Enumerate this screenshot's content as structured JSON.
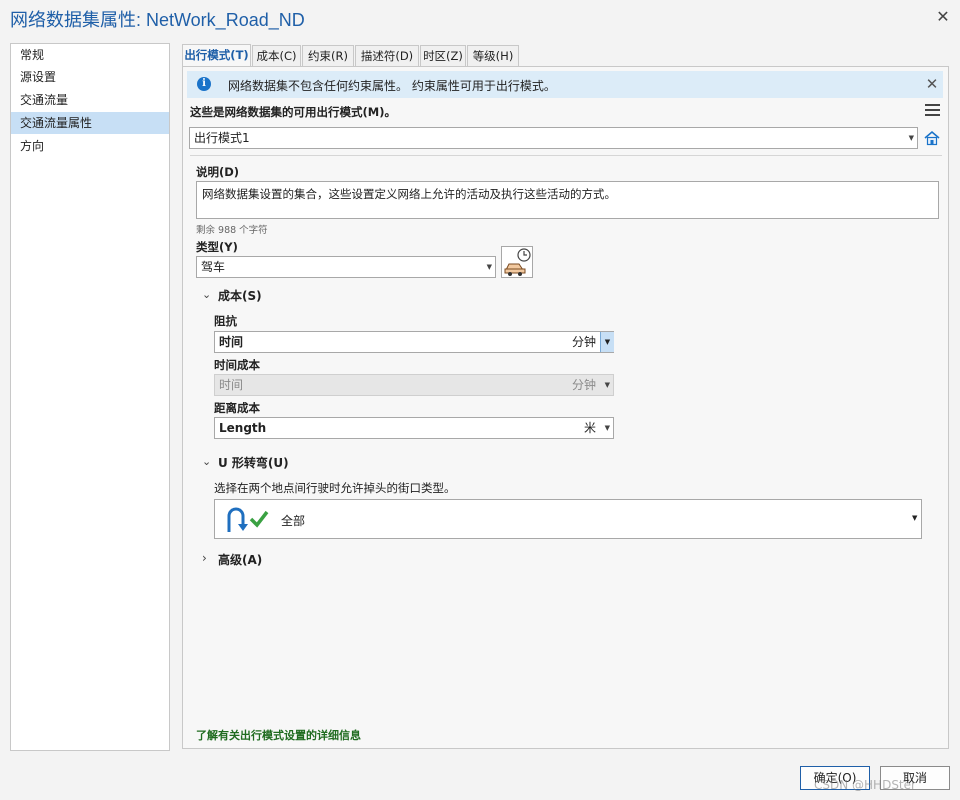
{
  "window": {
    "title": "网络数据集属性: NetWork_Road_ND"
  },
  "nav": {
    "items": [
      "常规",
      "源设置",
      "交通流量",
      "交通流量属性",
      "方向"
    ],
    "selected_index": 3
  },
  "tabs": [
    "出行模式(T)",
    "成本(C)",
    "约束(R)",
    "描述符(D)",
    "时区(Z)",
    "等级(H)"
  ],
  "active_tab": 0,
  "info_bar": {
    "text": "网络数据集不包含任何约束属性。 约束属性可用于出行模式。"
  },
  "modes": {
    "label": "这些是网络数据集的可用出行模式(M)。",
    "selected": "出行模式1"
  },
  "description": {
    "label": "说明(D)",
    "value": "网络数据集设置的集合，这些设置定义网络上允许的活动及执行这些活动的方式。",
    "remaining": "剩余 988 个字符"
  },
  "type": {
    "label": "类型(Y)",
    "value": "驾车"
  },
  "cost_section": {
    "title": "成本(S)",
    "impedance": {
      "label": "阻抗",
      "value": "时间",
      "unit": "分钟"
    },
    "time_cost": {
      "label": "时间成本",
      "value": "时间",
      "unit": "分钟"
    },
    "distance_cost": {
      "label": "距离成本",
      "value": "Length",
      "unit": "米"
    }
  },
  "uturn_section": {
    "title": "U 形转弯(U)",
    "description": "选择在两个地点间行驶时允许掉头的街口类型。",
    "value": "全部"
  },
  "advanced_section": {
    "title": "高级(A)"
  },
  "help_link": "了解有关出行模式设置的详细信息",
  "buttons": {
    "ok": "确定(O)",
    "cancel": "取消"
  },
  "watermark": "CSDN @HHDSter",
  "colors": {
    "accent": "#1f5fa8",
    "selected_nav": "#c7dff5",
    "info_bar": "#dcecf8",
    "link": "#1f6b1f"
  }
}
